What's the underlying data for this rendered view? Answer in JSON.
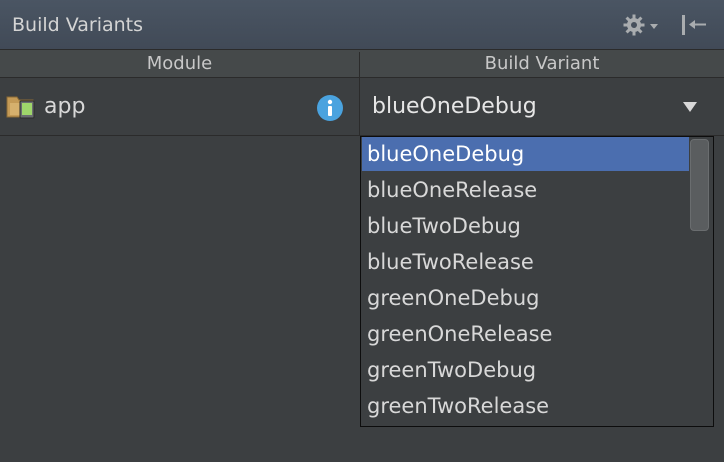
{
  "panel": {
    "title": "Build Variants",
    "settings_icon": "gear-icon",
    "hide_icon": "pin-collapse-icon"
  },
  "table": {
    "columns": [
      "Module",
      "Build Variant"
    ],
    "rows": [
      {
        "module": "app",
        "module_icon": "android-module-icon",
        "info_icon": "info-icon",
        "variant": "blueOneDebug"
      }
    ]
  },
  "variant_dropdown": {
    "selected": "blueOneDebug",
    "options": [
      "blueOneDebug",
      "blueOneRelease",
      "blueTwoDebug",
      "blueTwoRelease",
      "greenOneDebug",
      "greenOneRelease",
      "greenTwoDebug",
      "greenTwoRelease"
    ]
  },
  "colors": {
    "background": "#3c3f41",
    "titlebar": "#4a5563",
    "selection": "#4b6eaf",
    "text": "#d8d8d8",
    "info_icon": "#4aa3df"
  }
}
